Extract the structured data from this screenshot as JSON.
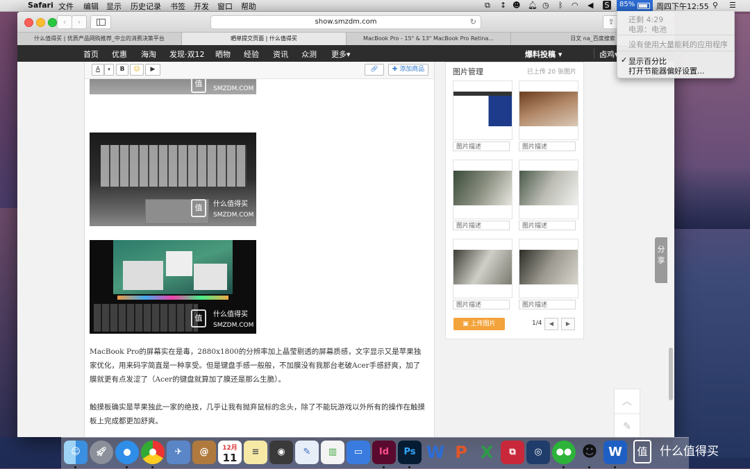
{
  "menubar": {
    "apple": "",
    "app_name": "Safari",
    "menus": [
      "文件",
      "编辑",
      "显示",
      "历史记录",
      "书签",
      "开发",
      "窗口",
      "帮助"
    ],
    "battery_percent": "85%",
    "clock": "周四下午12:55"
  },
  "battery_menu": {
    "remaining": "还剩 4:29",
    "source": "电源：电池",
    "no_apps": "没有使用大量能耗的应用程序",
    "show_percent": "显示百分比",
    "open_prefs": "打开节能器偏好设置..."
  },
  "browser": {
    "url": "show.smzdm.com",
    "tabs": [
      "什么值得买 | 优质产品网购推荐_中立的消费决策平台",
      "晒单提交页面 | 什么值得买",
      "MacBook Pro - 15\" & 13\" MacBook Pro Retina...",
      "日文 na_百度搜索"
    ]
  },
  "site_nav": {
    "links": [
      "首页",
      "优惠",
      "海淘",
      "发现·双12",
      "晒物",
      "经验",
      "资讯",
      "众测",
      "更多▾"
    ],
    "submit": "爆料投稿 ▾",
    "user": "卤鸡▾"
  },
  "editor": {
    "toolbar": {
      "font": "A",
      "bold": "B",
      "add_item": "✚ 添加商品"
    },
    "watermark": {
      "cn": "什么值得买",
      "en": "SMZDM.COM",
      "badge": "值"
    },
    "paragraphs": [
      "MacBook Pro的屏幕实在是毒，2880x1800的分辨率加上晶莹剔透的屏幕质感，文字显示又是苹果独家优化，用来码字简直是一种享受。但是键盘手感一般般，不加膜没有我那台老破Acer手感舒爽，加了膜就更有点发涩了（Acer的键盘就算加了膜还是那么生脆）。",
      "触摸板确实是苹果独此一家的绝技，几乎让我有抛弃鼠标的念头，除了不能玩游戏以外所有的操作在触摸板上完成都更加舒爽。"
    ]
  },
  "image_manager": {
    "title": "图片管理",
    "count": "已上传 20 张图片",
    "desc_placeholder": "图片描述",
    "upload": "上传图片",
    "page": "1/4",
    "prev": "◀",
    "next": "▶"
  },
  "share_tab": "分享",
  "dock_apps": [
    "Finder",
    "Launchpad",
    "Safari",
    "Chrome",
    "Preview",
    "Contacts",
    "Calendar",
    "Notes",
    "Photo Booth",
    "Keynote",
    "Numbers",
    "Keynote Remote",
    "InDesign",
    "Photoshop",
    "Word",
    "PowerPoint",
    "Excel",
    "Parallels",
    "Instruments",
    "WeChat",
    "QQ",
    "Word 2"
  ],
  "dock_labels": {
    "calendar_month": "12月",
    "calendar_day": "11",
    "indesign": "Id",
    "photoshop": "Ps",
    "word": "W",
    "ppt": "P",
    "excel": "X"
  },
  "corner_watermark": "什么值得买",
  "corner_badge": "值"
}
